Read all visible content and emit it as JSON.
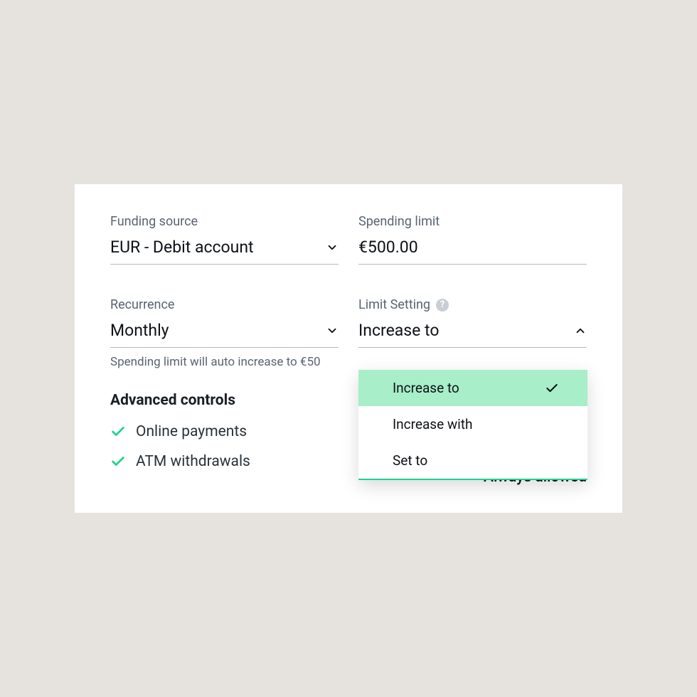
{
  "funding_source": {
    "label": "Funding source",
    "value": "EUR - Debit account"
  },
  "spending_limit": {
    "label": "Spending limit",
    "value": "€500.00"
  },
  "recurrence": {
    "label": "Recurrence",
    "value": "Monthly",
    "helper": "Spending limit will auto increase to €50"
  },
  "limit_setting": {
    "label": "Limit Setting",
    "value": "Increase to",
    "options": [
      {
        "label": "Increase to",
        "selected": true
      },
      {
        "label": "Increase with",
        "selected": false
      },
      {
        "label": "Set to",
        "selected": false
      }
    ]
  },
  "advanced_controls": {
    "title": "Advanced controls",
    "items": [
      {
        "label": "Online payments"
      },
      {
        "label": "ATM withdrawals"
      }
    ]
  },
  "always_allowed": "Always allowed"
}
